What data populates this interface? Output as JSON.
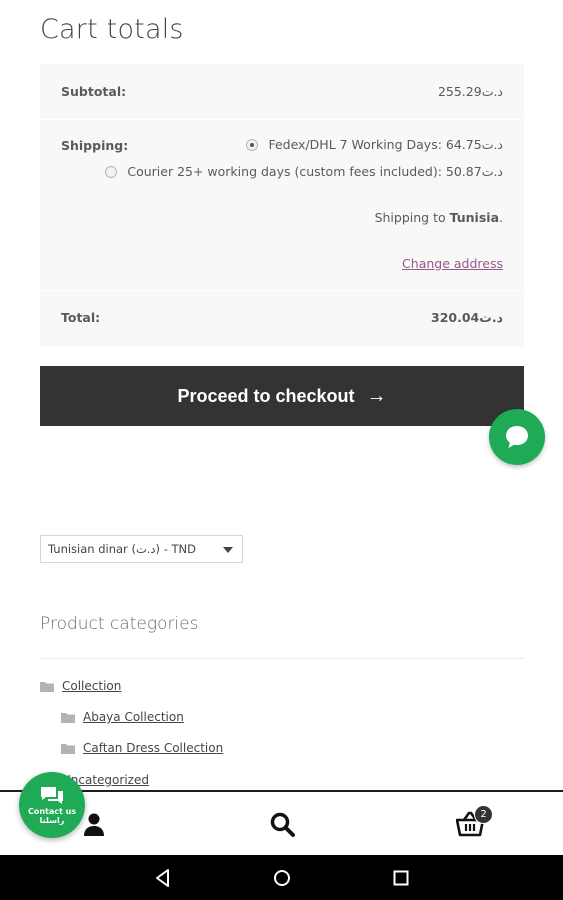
{
  "page": {
    "title": "Cart totals"
  },
  "totals": {
    "subtotal_label": "Subtotal:",
    "subtotal_value": "د.ت255.29",
    "shipping_label": "Shipping:",
    "shipping_options": [
      {
        "label": "Fedex/DHL 7 Working Days: د.ت64.75",
        "selected": true
      },
      {
        "label": "Courier 25+ working days (custom fees included): د.ت50.87",
        "selected": false
      }
    ],
    "shipping_to_text": "Shipping to ",
    "shipping_country": "Tunisia",
    "shipping_suffix": ".",
    "change_address": "Change address",
    "total_label": "Total:",
    "total_value": "د.ت320.04"
  },
  "checkout": {
    "label": "Proceed to checkout",
    "arrow": "→"
  },
  "currency": {
    "selected": "Tunisian dinar (د.ت) - TND"
  },
  "categories": {
    "title": "Product categories",
    "items": [
      {
        "label": "Collection"
      },
      {
        "label": "Abaya Collection"
      },
      {
        "label": "Caftan Dress Collection"
      },
      {
        "label": "Uncategorized"
      }
    ]
  },
  "contact": {
    "line1": "Contact us",
    "line2": "راسلنا"
  },
  "bottom_nav": {
    "cart_count": "2"
  },
  "icons": [
    "chat-icon",
    "folder-icon",
    "user-icon",
    "search-icon",
    "basket-icon",
    "back-icon",
    "home-icon",
    "recents-icon"
  ],
  "colors": {
    "accent": "#1faa55",
    "button": "#333333",
    "link": "#96588a",
    "panel": "#f8f8f8"
  }
}
